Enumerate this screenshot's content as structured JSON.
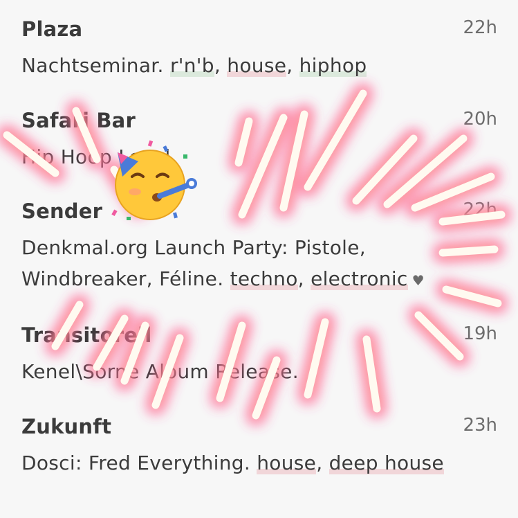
{
  "events": [
    {
      "venue": "Plaza",
      "time": "22h",
      "desc_text": "Nachtseminar.",
      "tags": [
        {
          "text": "r'n'b",
          "color": "green"
        },
        {
          "text": "house",
          "color": "pink"
        },
        {
          "text": "hiphop",
          "color": "green"
        }
      ]
    },
    {
      "venue": "Safari Bar",
      "time": "20h",
      "desc_text": "Hip Hoop Level",
      "tags": []
    },
    {
      "venue": "Sender",
      "time": "22h",
      "desc_line1": "Denkmal.org Launch Party: Pistole,",
      "desc_line2": "Windbreaker, Féline.",
      "tags": [
        {
          "text": "techno",
          "color": "pink"
        },
        {
          "text": "electronic",
          "color": "pink"
        }
      ],
      "heart": "♥"
    },
    {
      "venue": "Transitorell",
      "time": "19h",
      "desc_text": "Kenel\\Sorne Album Release.",
      "tags": []
    },
    {
      "venue": "Zukunft",
      "time": "23h",
      "desc_text": "Dosci: Fred Everything.",
      "tags": [
        {
          "text": "house",
          "color": "pink"
        },
        {
          "text": "deep house",
          "color": "pink"
        }
      ]
    }
  ],
  "sticker": {
    "icon": "partying-face-emoji",
    "glow_color": "#ff3ea5",
    "burst_color": "#ffd9a0"
  }
}
